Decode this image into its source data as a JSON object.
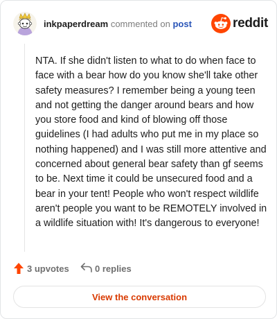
{
  "header": {
    "username": "inkpaperdream",
    "commented_text": "commented on",
    "post_link": "post",
    "avatar_icon": "snoo-avatar-icon",
    "brand_icon": "reddit-alien-icon",
    "brand_name": "reddit"
  },
  "comment": {
    "body": "NTA. If she didn't listen to what to do when face to face with a bear how do you know she'll take other safety measures? I remember being a young teen and not getting the danger around bears and how you store food and kind of blowing off those guidelines (I had adults who put me in my place so nothing happened) and I was still more attentive and concerned about general bear safety than gf seems to be. Next time it could be unsecured food and a bear in your tent! People who won't respect wildlife aren't people you want to be REMOTELY involved in a wildlife situation with! It's dangerous to everyone!"
  },
  "actions": {
    "upvotes_label": "3 upvotes",
    "upvote_icon": "upvote-arrow-icon",
    "replies_label": "0 replies",
    "reply_icon": "reply-arrow-icon"
  },
  "cta": {
    "label": "View the conversation"
  },
  "colors": {
    "brand": "#ff4500",
    "upvote": "#ff4500",
    "cta_text": "#d93a00",
    "post_link": "#2a55b8",
    "text": "#1c1c1c",
    "muted": "#7c7c7c"
  }
}
